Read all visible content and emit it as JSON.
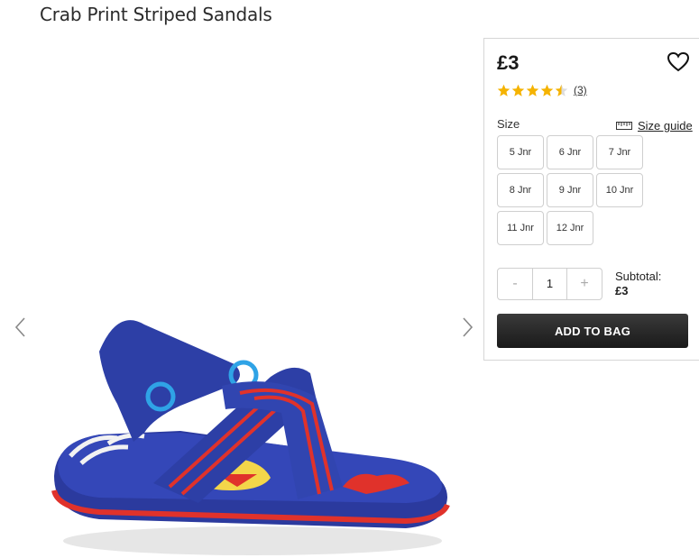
{
  "product": {
    "title": "Crab Print Striped Sandals",
    "price": "£3",
    "rating_value": 4.5,
    "rating_max": 5,
    "review_count": "(3)",
    "favourite_icon": "heart-outline-icon"
  },
  "size": {
    "label": "Size",
    "guide_label": "Size guide",
    "guide_icon": "ruler-icon",
    "options": [
      "5 Jnr",
      "6 Jnr",
      "7 Jnr",
      "8 Jnr",
      "9 Jnr",
      "10 Jnr",
      "11 Jnr",
      "12 Jnr"
    ]
  },
  "quantity": {
    "decrement": "-",
    "value": "1",
    "increment": "+"
  },
  "subtotal": {
    "label": "Subtotal:",
    "amount": "£3"
  },
  "cta": {
    "add_to_bag": "ADD TO BAG"
  },
  "gallery": {
    "prev_icon": "chevron-left-icon",
    "next_icon": "chevron-right-icon",
    "image": "sandal-product-image"
  },
  "colors": {
    "star": "#f5b301",
    "button": "#222222",
    "sandal_strap": "#2d3fa6",
    "sandal_stripe": "#e0322b"
  }
}
